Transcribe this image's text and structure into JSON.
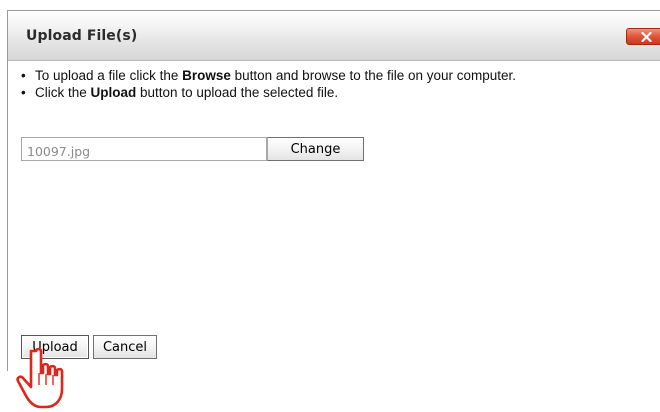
{
  "dialog": {
    "title": "Upload File(s)",
    "close_icon": "close-x-icon",
    "close_color": "#d94a2f"
  },
  "instructions": {
    "items": [
      {
        "before": "To upload a file click the ",
        "bold": "Browse",
        "after": " button and browse to the file on your computer."
      },
      {
        "before": "Click the ",
        "bold": "Upload",
        "after": " button to upload the selected file."
      }
    ],
    "bullet": "•"
  },
  "file": {
    "value": "10097.jpg",
    "change_label": "Change"
  },
  "actions": {
    "upload_label": "Upload",
    "cancel_label": "Cancel"
  },
  "cursor": {
    "icon": "hand-pointer-icon",
    "color": "#e0261b"
  }
}
